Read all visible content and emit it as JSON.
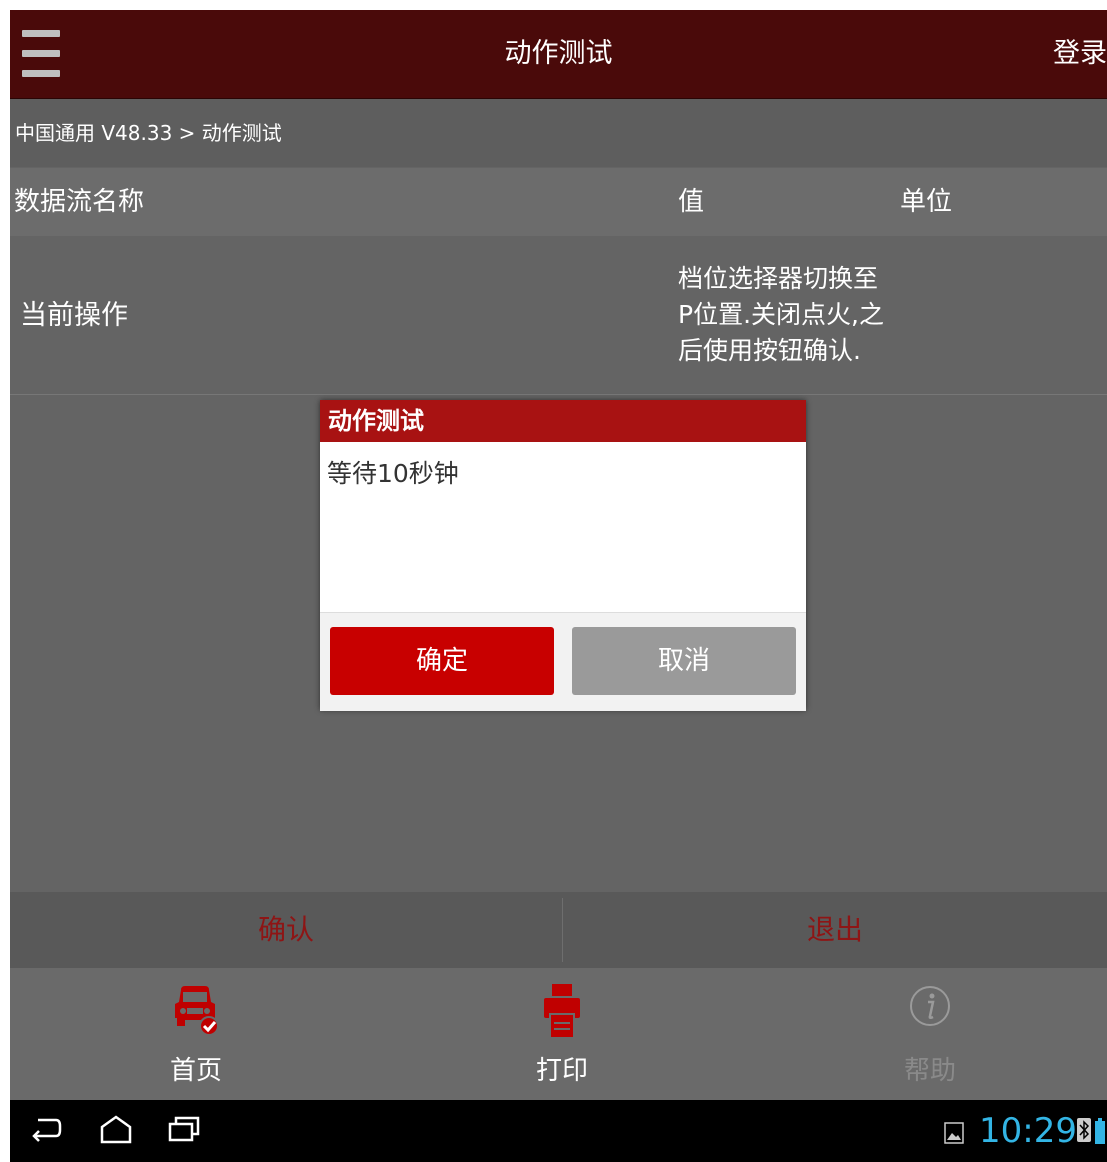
{
  "header": {
    "title": "动作测试",
    "login_label": "登录"
  },
  "breadcrumb": "中国通用 V48.33 > 动作测试",
  "table": {
    "columns": [
      "数据流名称",
      "值",
      "单位"
    ],
    "rows": [
      {
        "name": "当前操作",
        "value": "档位选择器切换至P位置.关闭点火,之后使用按钮确认.",
        "unit": ""
      }
    ]
  },
  "actions": {
    "confirm_label": "确认",
    "exit_label": "退出"
  },
  "bottom_nav": {
    "items": [
      {
        "label": "首页",
        "icon": "car-check-icon"
      },
      {
        "label": "打印",
        "icon": "printer-icon"
      },
      {
        "label": "帮助",
        "icon": "info-icon"
      }
    ]
  },
  "dialog": {
    "title": "动作测试",
    "message": "等待10秒钟",
    "ok_label": "确定",
    "cancel_label": "取消"
  },
  "system_bar": {
    "time": "10:29"
  },
  "colors": {
    "header_bg": "#4a0a0a",
    "accent_red": "#c80000",
    "dialog_title_bg": "#a81212",
    "cancel_gray": "#9a9a9a",
    "clock_blue": "#33b5e5"
  }
}
